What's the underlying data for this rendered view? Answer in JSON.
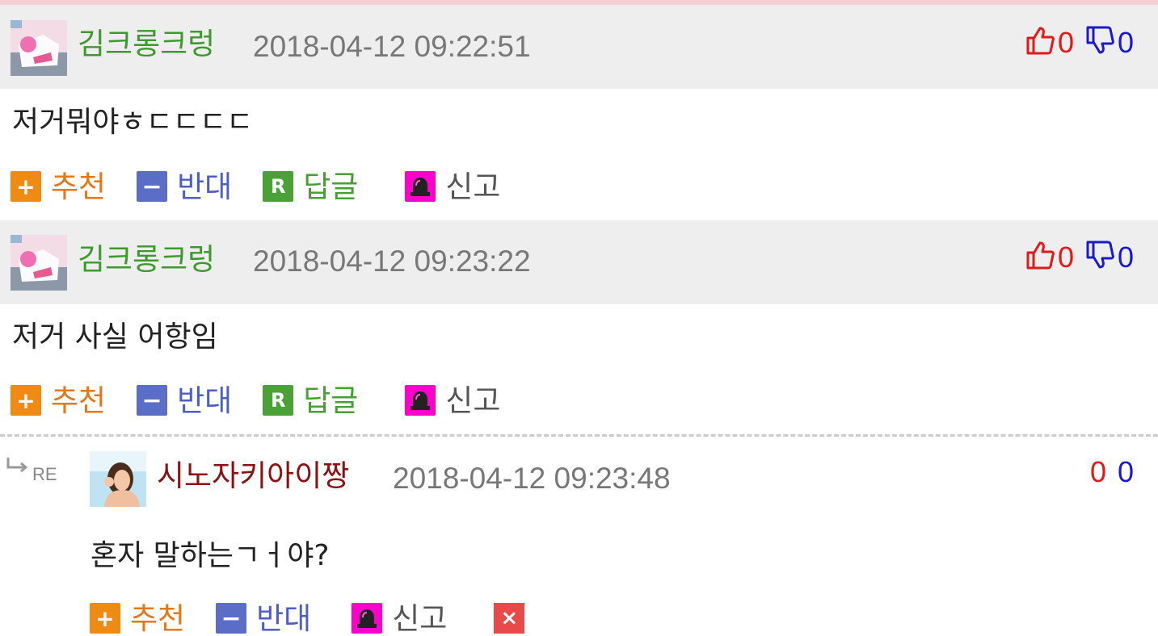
{
  "comments": [
    {
      "nickname": "김크롱크렁",
      "timestamp": "2018-04-12 09:22:51",
      "up_count": "0",
      "down_count": "0",
      "text": "저거뭐야ㅎㄷㄷㄷㄷ"
    },
    {
      "nickname": "김크롱크렁",
      "timestamp": "2018-04-12 09:23:22",
      "up_count": "0",
      "down_count": "0",
      "text": "저거 사실 어항임"
    }
  ],
  "reply": {
    "re_label": "RE",
    "nickname": "시노자키아이짱",
    "timestamp": "2018-04-12 09:23:48",
    "up_count": "0",
    "down_count": "0",
    "text": "혼자 말하는ㄱㅓ야?"
  },
  "actions": {
    "recommend": "추천",
    "oppose": "반대",
    "reply": "답글",
    "report": "신고"
  },
  "icons": {
    "recommend": "plus-icon",
    "oppose": "minus-icon",
    "reply": "r-icon",
    "report": "siren-icon",
    "thumbs_up": "thumbs-up-icon",
    "thumbs_down": "thumbs-down-icon",
    "delete": "close-icon"
  },
  "colors": {
    "nickname_green": "#3c9a2d",
    "nickname_red": "#8b1212",
    "vote_up": "#e01a1a",
    "vote_down": "#1a1ac8",
    "recommend": "#e2781a",
    "oppose": "#4d5fc6",
    "reply": "#46a133",
    "report_icon": "#ff00cc"
  }
}
